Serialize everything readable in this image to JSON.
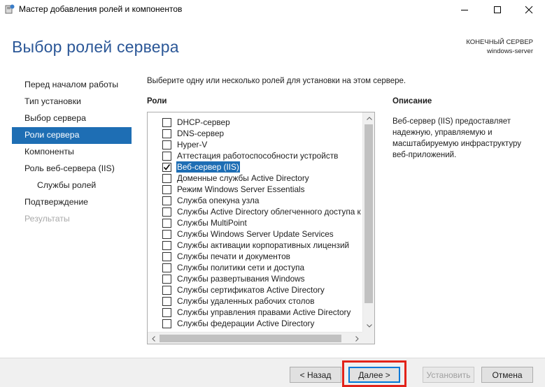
{
  "window": {
    "title": "Мастер добавления ролей и компонентов"
  },
  "header": {
    "title": "Выбор ролей сервера",
    "destination_label": "КОНЕЧНЫЙ СЕРВЕР",
    "destination_value": "windows-server"
  },
  "nav": {
    "items": [
      {
        "label": "Перед началом работы"
      },
      {
        "label": "Тип установки"
      },
      {
        "label": "Выбор сервера"
      },
      {
        "label": "Роли сервера"
      },
      {
        "label": "Компоненты"
      },
      {
        "label": "Роль веб-сервера (IIS)"
      },
      {
        "label": "Службы ролей"
      },
      {
        "label": "Подтверждение"
      },
      {
        "label": "Результаты"
      }
    ]
  },
  "main": {
    "instruction": "Выберите одну или несколько ролей для установки на этом сервере.",
    "roles_heading": "Роли",
    "roles": [
      {
        "label": "DHCP-сервер",
        "checked": false
      },
      {
        "label": "DNS-сервер",
        "checked": false
      },
      {
        "label": "Hyper-V",
        "checked": false
      },
      {
        "label": "Аттестация работоспособности устройств",
        "checked": false
      },
      {
        "label": "Веб-сервер (IIS)",
        "checked": true
      },
      {
        "label": "Доменные службы Active Directory",
        "checked": false
      },
      {
        "label": "Режим Windows Server Essentials",
        "checked": false
      },
      {
        "label": "Служба опекуна узла",
        "checked": false
      },
      {
        "label": "Службы Active Directory облегченного доступа к",
        "checked": false
      },
      {
        "label": "Службы MultiPoint",
        "checked": false
      },
      {
        "label": "Службы Windows Server Update Services",
        "checked": false
      },
      {
        "label": "Службы активации корпоративных лицензий",
        "checked": false
      },
      {
        "label": "Службы печати и документов",
        "checked": false
      },
      {
        "label": "Службы политики сети и доступа",
        "checked": false
      },
      {
        "label": "Службы развертывания Windows",
        "checked": false
      },
      {
        "label": "Службы сертификатов Active Directory",
        "checked": false
      },
      {
        "label": "Службы удаленных рабочих столов",
        "checked": false
      },
      {
        "label": "Службы управления правами Active Directory",
        "checked": false
      },
      {
        "label": "Службы федерации Active Directory",
        "checked": false
      }
    ],
    "description_heading": "Описание",
    "description_text": "Веб-сервер (IIS) предоставляет надежную, управляемую и масштабируемую инфраструктуру веб-приложений."
  },
  "footer": {
    "back_label": "< Назад",
    "next_label": "Далее >",
    "install_label": "Установить",
    "cancel_label": "Отмена"
  },
  "colors": {
    "title_blue": "#2b5797",
    "selection_blue": "#1e6eb4",
    "highlight_red": "#e2231a"
  }
}
